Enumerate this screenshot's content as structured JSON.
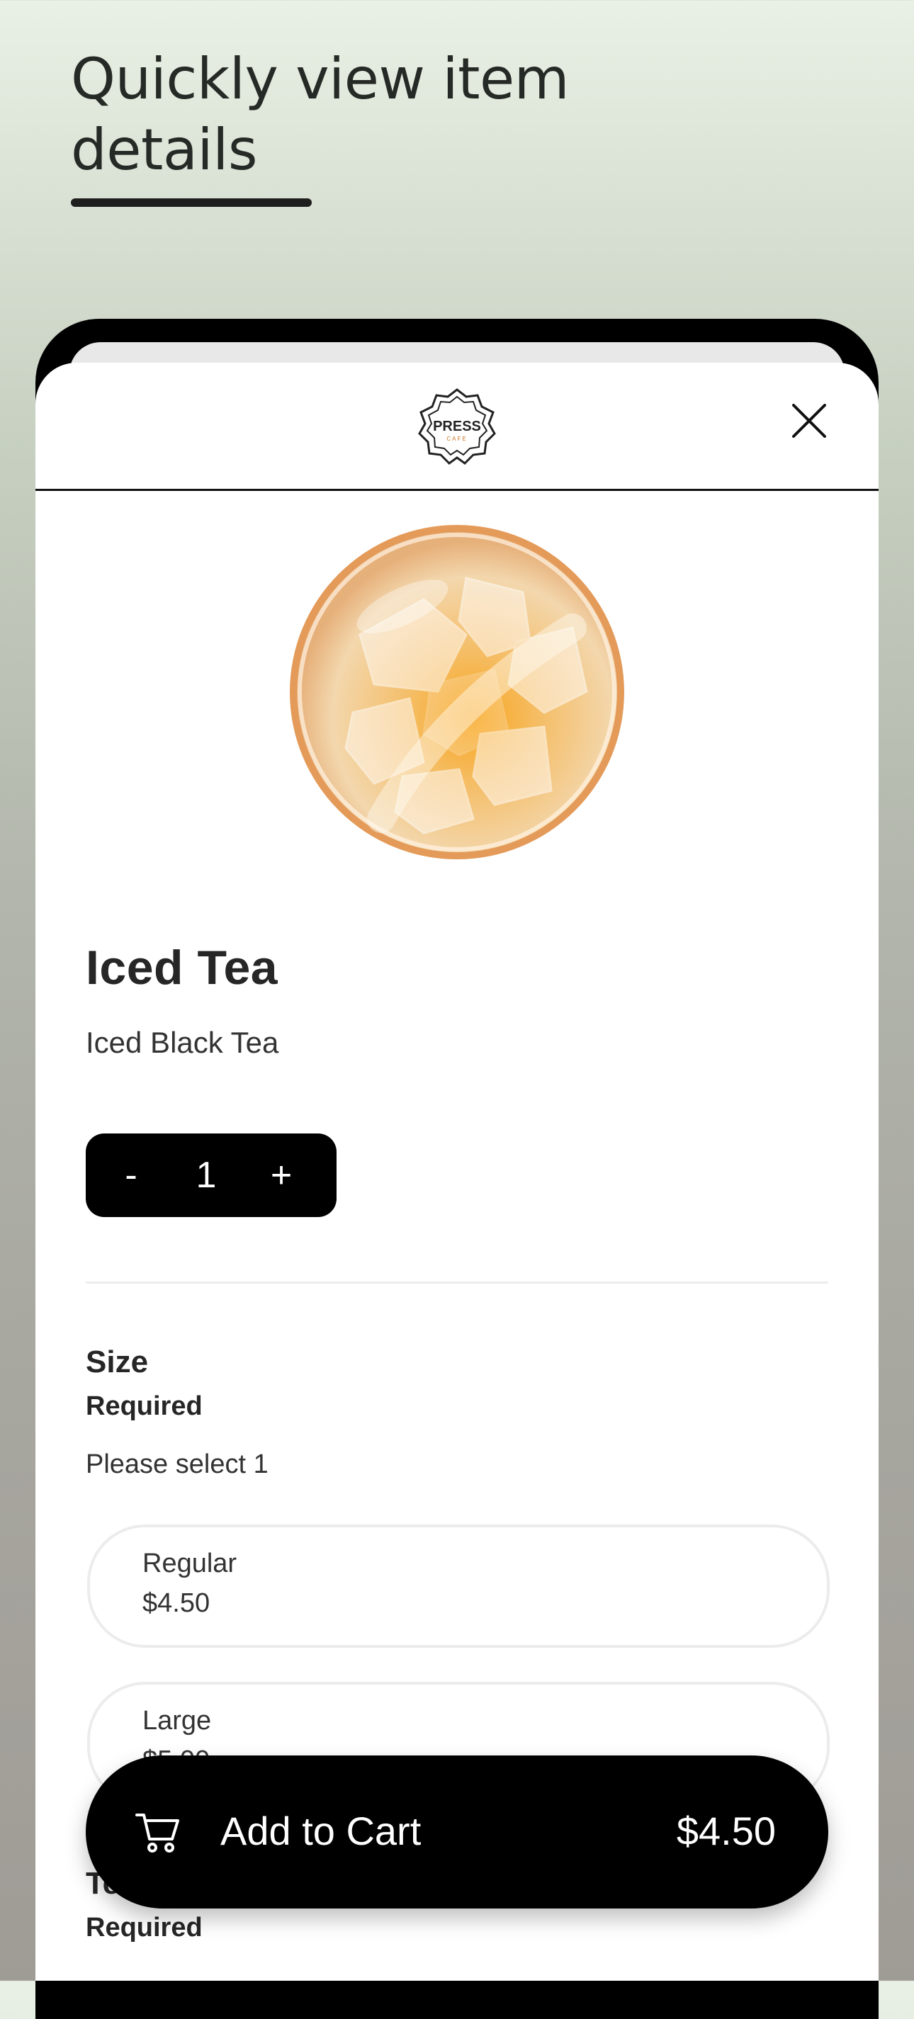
{
  "promo": {
    "headline": "Quickly view item details"
  },
  "header": {
    "logo_text": "PRESS",
    "logo_subtext": "CAFE"
  },
  "product": {
    "name": "Iced Tea",
    "description": "Iced Black Tea",
    "image": "iced-tea-photo"
  },
  "quantity": {
    "minus": "-",
    "value": "1",
    "plus": "+"
  },
  "size_section": {
    "title": "Size",
    "required": "Required",
    "hint": "Please select 1",
    "options": [
      {
        "label": "Regular",
        "price": "$4.50"
      },
      {
        "label": "Large",
        "price": "$5.00"
      }
    ]
  },
  "next_section": {
    "title": "Tea",
    "required": "Required"
  },
  "cart_button": {
    "label": "Add to Cart",
    "price": "$4.50"
  },
  "colors": {
    "accent": "#000000",
    "background_top": "#e9f0e5",
    "background_bottom": "#9f9c96"
  },
  "icons": {
    "close": "close-icon",
    "cart": "cart-icon"
  }
}
